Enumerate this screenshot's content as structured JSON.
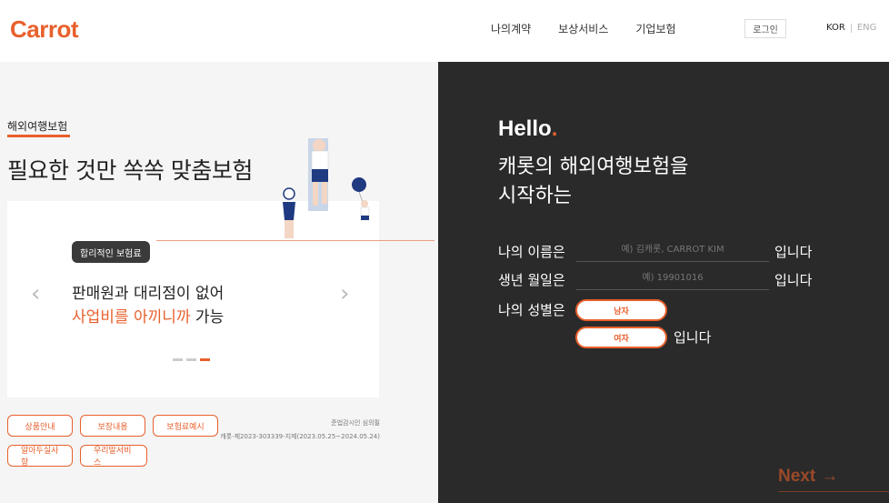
{
  "brand": "Carrot",
  "nav": {
    "items": [
      "나의계약",
      "보상서비스",
      "기업보험"
    ],
    "login": "로그인",
    "lang_kor": "KOR",
    "lang_eng": "ENG"
  },
  "left": {
    "category": "해외여행보험",
    "headline": "필요한 것만 쏙쏙 맞춤보험",
    "tooltip": "합리적인 보험료",
    "slide_line1": "판매원과 대리점이 없어",
    "slide_line2_highlight": "사업비를 아끼니까",
    "slide_line2_rest": " 가능",
    "buttons_row1": [
      "상품안내",
      "보장내용",
      "보험료예시"
    ],
    "buttons_row2": [
      "알아두실사항",
      "우리말서비스"
    ],
    "notice1": "준법감시인 심의필",
    "notice2": "캐롯-제2023-303339-지제(2023.05.25~2024.05.24)",
    "slider_active_index": 2
  },
  "right": {
    "hello": "Hello",
    "hello_dot": ".",
    "intro_line1": "캐롯의 해외여행보험을",
    "intro_line2": "시작하는",
    "name_label": "나의 이름은",
    "name_placeholder": "예) 김캐롯, CARROT KIM",
    "birth_label": "생년 월일은",
    "birth_placeholder": "예) 19901016",
    "suffix": "입니다",
    "gender_label": "나의 성별은",
    "male": "남자",
    "female": "여자",
    "next": "Next",
    "next_arrow": "→"
  },
  "colors": {
    "accent": "#e8602c",
    "dark": "#2a2a2a",
    "light": "#f5f5f5"
  }
}
